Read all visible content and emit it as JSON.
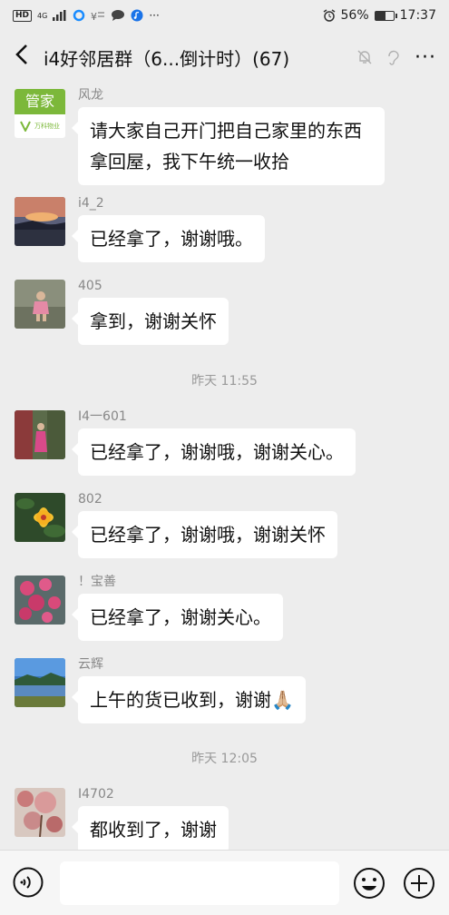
{
  "status_bar": {
    "hd": "HD",
    "network": "4G",
    "battery": "56%",
    "battery_level": 0.56,
    "time": "17:37"
  },
  "header": {
    "back_icon": "chevron-left-icon",
    "title": "i4好邻居群（6...倒计时）(67)",
    "more": "···"
  },
  "messages": [
    {
      "sender": "风龙",
      "text": "请大家自己开门把自己家里的东西拿回屋，我下午统一收拾",
      "avatar_label": "管家",
      "avatar_sub": "万科物业"
    },
    {
      "sender": "i4_2",
      "text": "已经拿了，谢谢哦。"
    },
    {
      "sender": "405",
      "text": "拿到，谢谢关怀"
    },
    {
      "sender": "I4一601",
      "text": "已经拿了，谢谢哦，谢谢关心。"
    },
    {
      "sender": "802",
      "text": "已经拿了，谢谢哦，谢谢关怀"
    },
    {
      "sender": "！宝善",
      "text": "已经拿了，谢谢关心。"
    },
    {
      "sender": "云辉",
      "text": "上午的货已收到，谢谢🙏🏼"
    },
    {
      "sender": "I4702",
      "text": "都收到了，谢谢"
    }
  ],
  "timestamps": [
    "昨天 11:55",
    "昨天 12:05"
  ],
  "input_bar": {
    "voice_icon": "voice-icon",
    "emoji_icon": "emoji-icon",
    "plus_icon": "plus-icon"
  },
  "colors": {
    "background": "#ededed",
    "bubble": "#ffffff",
    "avatar_brand": "#7cb83a"
  }
}
